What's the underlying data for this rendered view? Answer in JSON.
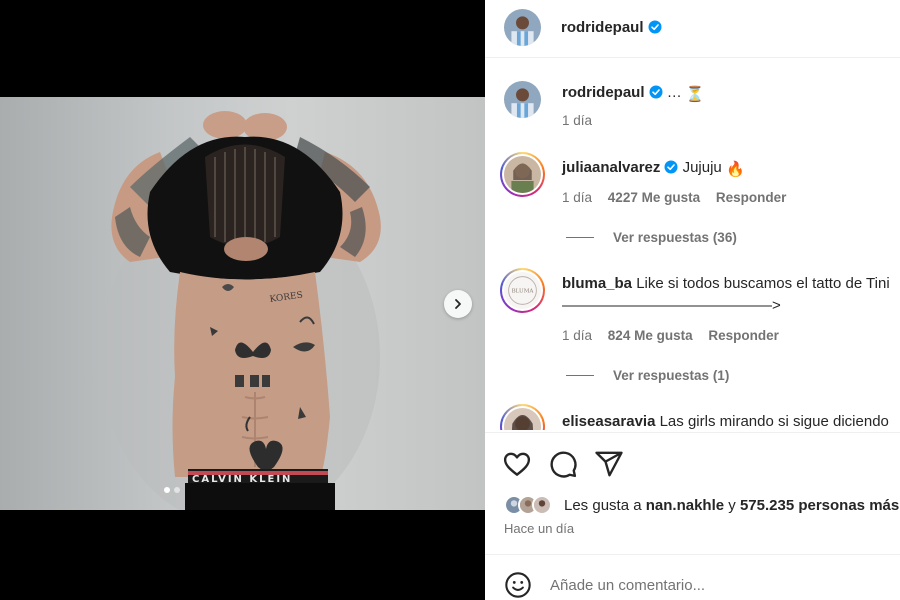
{
  "post": {
    "author": "rodridepaul",
    "verified": true,
    "photo_alt": "",
    "carousel": {
      "total": 2,
      "active": 0
    }
  },
  "caption": {
    "user": "rodridepaul",
    "text": "…",
    "emoji": "⏳",
    "time": "1 día"
  },
  "comments": [
    {
      "user": "juliaanalvarez",
      "verified": true,
      "text": "Jujuju",
      "emoji": "🔥",
      "time": "1 día",
      "likes": "4227 Me gusta",
      "reply_label": "Responder",
      "view_replies": "Ver respuestas (36)"
    },
    {
      "user": "bluma_ba",
      "verified": false,
      "text": "Like si todos buscamos el tatto de Tini",
      "text_line2": "——————————————>",
      "time": "1 día",
      "likes": "824 Me gusta",
      "reply_label": "Responder",
      "view_replies": "Ver respuestas (1)"
    },
    {
      "user": "eliseasaravia",
      "verified": false,
      "text": "Las girls mirando si sigue diciendo"
    }
  ],
  "likes": {
    "prefix": "Les gusta a",
    "user": "nan.nakhle",
    "connector": "y",
    "count": "575.235 personas más"
  },
  "posted": "Hace un día",
  "add_comment": {
    "placeholder": "Añade un comentario..."
  },
  "colors": {
    "verified": "#0095f6",
    "meta": "#737373",
    "text": "#262626"
  },
  "icons": [
    "heart-icon",
    "comment-icon",
    "share-icon",
    "emoji-icon",
    "chevron-right-icon",
    "verified-badge-icon"
  ]
}
